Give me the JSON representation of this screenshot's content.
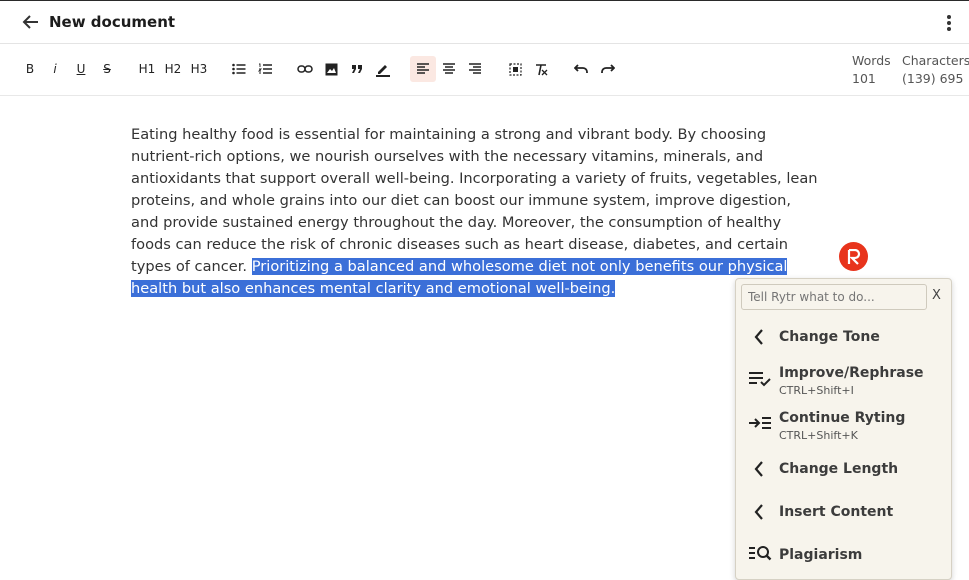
{
  "header": {
    "title": "New document"
  },
  "toolbar": {
    "bold": "B",
    "italic": "i",
    "underline": "U",
    "strike": "S",
    "h1": "H1",
    "h2": "H2",
    "h3": "H3"
  },
  "stats": {
    "words_label": "Words",
    "words_value": "101",
    "chars_label": "Characters",
    "chars_value": "(139) 695"
  },
  "document": {
    "text_plain": "Eating healthy food is essential for maintaining a strong and vibrant body. By choosing nutrient-rich options, we nourish ourselves with the necessary vitamins, minerals, and antioxidants that support overall well-being. Incorporating a variety of fruits, vegetables, lean proteins, and whole grains into our diet can boost our immune system, improve digestion, and provide sustained energy throughout the day. Moreover, the consumption of healthy foods can reduce the risk of chronic diseases such as heart disease, diabetes, and certain types of cancer. ",
    "text_selected": "Prioritizing a balanced and wholesome diet not only benefits our physical health but also enhances mental clarity and emotional well-being."
  },
  "rytr": {
    "badge": "R",
    "input_placeholder": "Tell Rytr what to do...",
    "close": "X",
    "items": [
      {
        "label": "Change Tone",
        "shortcut": "",
        "icon": "chevron-left-icon"
      },
      {
        "label": "Improve/Rephrase",
        "shortcut": "CTRL+Shift+I",
        "icon": "improve-icon"
      },
      {
        "label": "Continue Ryting",
        "shortcut": "CTRL+Shift+K",
        "icon": "continue-icon"
      },
      {
        "label": "Change Length",
        "shortcut": "",
        "icon": "chevron-left-icon"
      },
      {
        "label": "Insert Content",
        "shortcut": "",
        "icon": "chevron-left-icon"
      },
      {
        "label": "Plagiarism",
        "shortcut": "",
        "icon": "plagiarism-icon"
      }
    ]
  },
  "colors": {
    "selection": "#3b6fd8",
    "accent": "#e8341c",
    "panel_bg": "#f7f4ec"
  }
}
